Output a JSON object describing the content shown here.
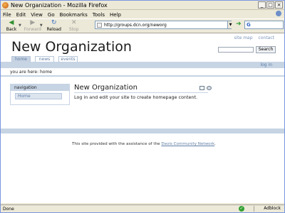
{
  "window": {
    "title": "New Organization - Mozilla Firefox"
  },
  "menu": [
    "File",
    "Edit",
    "View",
    "Go",
    "Bookmarks",
    "Tools",
    "Help"
  ],
  "toolbar": {
    "back_label": "Back",
    "forward_label": "Forward",
    "reload_label": "Reload",
    "stop_label": "Stop",
    "url": "http://groups.dcn.org/neworg"
  },
  "site": {
    "links": {
      "sitemap": "site map",
      "contact": "contact"
    },
    "title": "New Organization",
    "search_button": "Search",
    "tabs": [
      {
        "label": "home",
        "active": true
      },
      {
        "label": "news",
        "active": false
      },
      {
        "label": "events",
        "active": false
      }
    ],
    "login": "log in",
    "breadcrumb": "you are here: home",
    "nav": {
      "header": "navigation",
      "items": [
        "Home"
      ]
    },
    "page": {
      "title": "New Organization",
      "body": "Log in and edit your site to create homepage content."
    },
    "footer": {
      "pre": "This site provided with the assistance of the ",
      "link": "Davis Community Network",
      "post": "."
    }
  },
  "status": {
    "text": "Done",
    "adblock": "Adblock"
  }
}
